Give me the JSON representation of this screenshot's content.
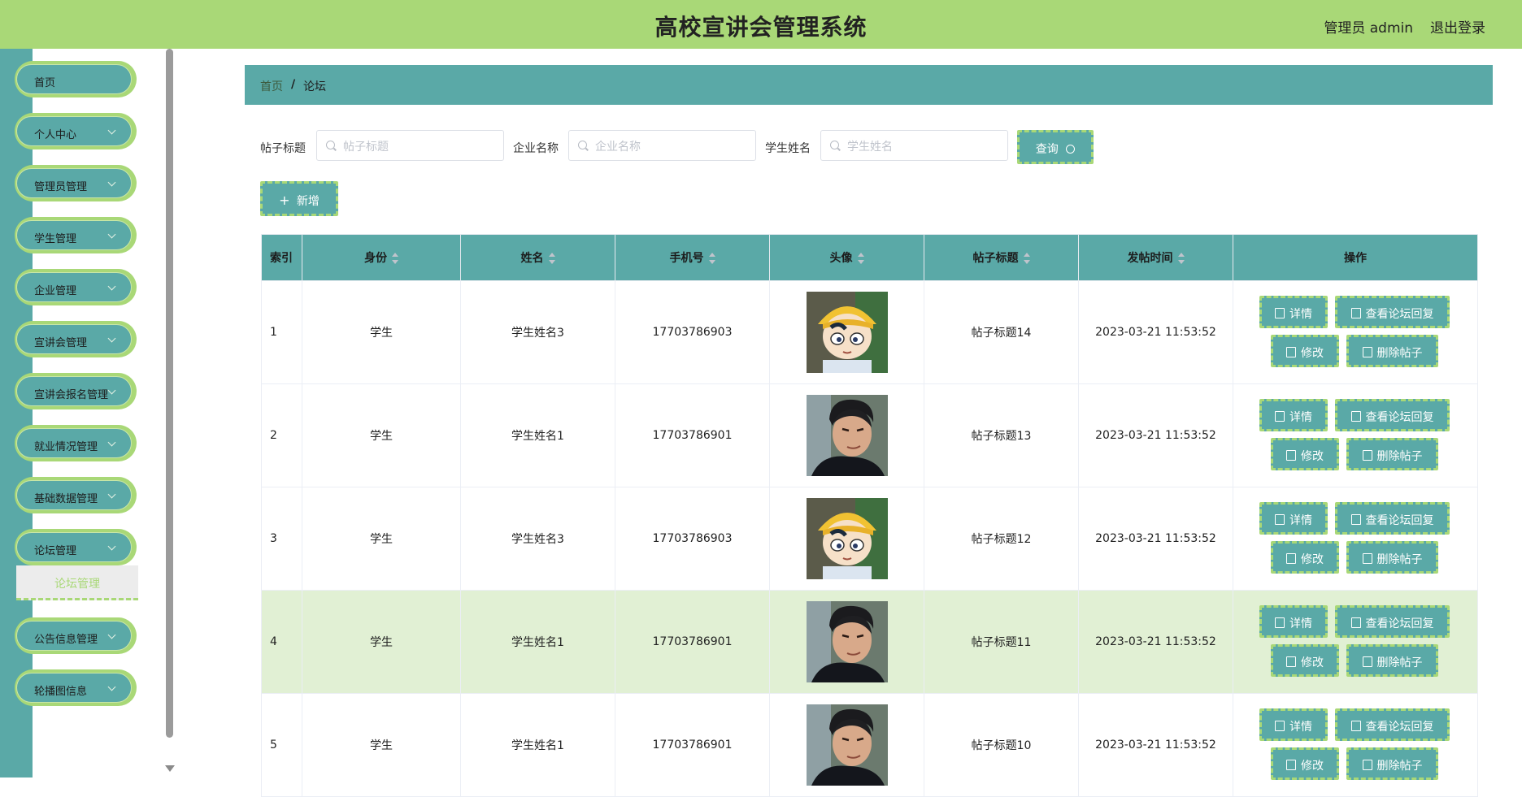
{
  "header": {
    "title": "高校宣讲会管理系统",
    "user": "管理员 admin",
    "logout": "退出登录"
  },
  "sidebar": {
    "items": [
      {
        "label": "首页"
      },
      {
        "label": "个人中心"
      },
      {
        "label": "管理员管理"
      },
      {
        "label": "学生管理"
      },
      {
        "label": "企业管理"
      },
      {
        "label": "宣讲会管理"
      },
      {
        "label": "宣讲会报名管理"
      },
      {
        "label": "就业情况管理"
      },
      {
        "label": "基础数据管理"
      },
      {
        "label": "论坛管理"
      },
      {
        "label": "公告信息管理"
      },
      {
        "label": "轮播图信息"
      }
    ],
    "submenu": {
      "label": "论坛管理"
    }
  },
  "breadcrumb": {
    "home": "首页",
    "sep": "/",
    "current": "论坛"
  },
  "search": {
    "title_label": "帖子标题",
    "title_placeholder": "帖子标题",
    "company_label": "企业名称",
    "company_placeholder": "企业名称",
    "student_label": "学生姓名",
    "student_placeholder": "学生姓名",
    "button": "查询"
  },
  "add_button": "新增",
  "table": {
    "headers": [
      "索引",
      "身份",
      "姓名",
      "手机号",
      "头像",
      "帖子标题",
      "发帖时间",
      "操作"
    ],
    "rows": [
      {
        "index": "1",
        "role": "学生",
        "name": "学生姓名3",
        "phone": "17703786903",
        "avatar": "cartoon-avatar",
        "title": "帖子标题14",
        "time": "2023-03-21 11:53:52"
      },
      {
        "index": "2",
        "role": "学生",
        "name": "学生姓名1",
        "phone": "17703786901",
        "avatar": "photo-avatar",
        "title": "帖子标题13",
        "time": "2023-03-21 11:53:52"
      },
      {
        "index": "3",
        "role": "学生",
        "name": "学生姓名3",
        "phone": "17703786903",
        "avatar": "cartoon-avatar",
        "title": "帖子标题12",
        "time": "2023-03-21 11:53:52"
      },
      {
        "index": "4",
        "role": "学生",
        "name": "学生姓名1",
        "phone": "17703786901",
        "avatar": "photo-avatar",
        "title": "帖子标题11",
        "time": "2023-03-21 11:53:52"
      },
      {
        "index": "5",
        "role": "学生",
        "name": "学生姓名1",
        "phone": "17703786901",
        "avatar": "photo-avatar",
        "title": "帖子标题10",
        "time": "2023-03-21 11:53:52"
      }
    ],
    "actions": {
      "detail": "详情",
      "view_reply": "查看论坛回复",
      "edit": "修改",
      "delete": "删除帖子"
    }
  },
  "colors": {
    "header": "#a9d877",
    "primary": "#5aa9a7",
    "highlight_row": "#e1f0d4"
  }
}
